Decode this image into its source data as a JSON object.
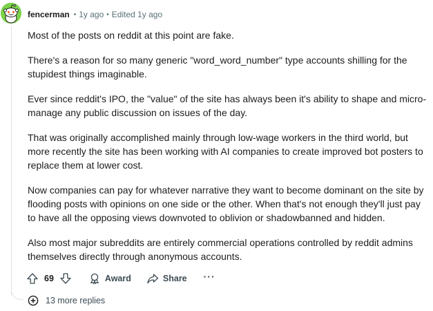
{
  "comment": {
    "username": "fencerman",
    "posted": "1y ago",
    "edited": "Edited 1y ago",
    "separator": "•",
    "paragraphs": [
      "Most of the posts on reddit at this point are fake.",
      "There's a reason for so many generic \"word_word_number\" type accounts shilling for the stupidest things imaginable.",
      "Ever since reddit's IPO, the \"value\" of the site has always been it's ability to shape and micro-manage any public discussion on issues of the day.",
      "That was originally accomplished mainly through low-wage workers in the third world, but more recently the site has been working with AI companies to create improved bot posters to replace them at lower cost.",
      "Now companies can pay for whatever narrative they want to become dominant on the site by flooding posts with opinions on one side or the other. When that's not enough they'll just pay to have all the opposing views downvoted to oblivion or shadowbanned and hidden.",
      "Also most major subreddits are entirely commercial operations controlled by reddit admins themselves directly through anonymous accounts."
    ]
  },
  "actions": {
    "score": "69",
    "award_label": "Award",
    "share_label": "Share",
    "more_label": "···"
  },
  "replies": {
    "more_label": "13 more replies"
  },
  "icons": {
    "avatar": "snoo-avatar",
    "upvote": "upvote-arrow-icon",
    "downvote": "downvote-arrow-icon",
    "award": "award-icon",
    "share": "share-icon",
    "more": "overflow-dots-icon",
    "expand": "plus-circle-icon"
  },
  "colors": {
    "avatar_bg": "#7cd24a",
    "text": "#1c1c1c",
    "meta": "#576f76",
    "thread_line": "#e0e0e0"
  }
}
